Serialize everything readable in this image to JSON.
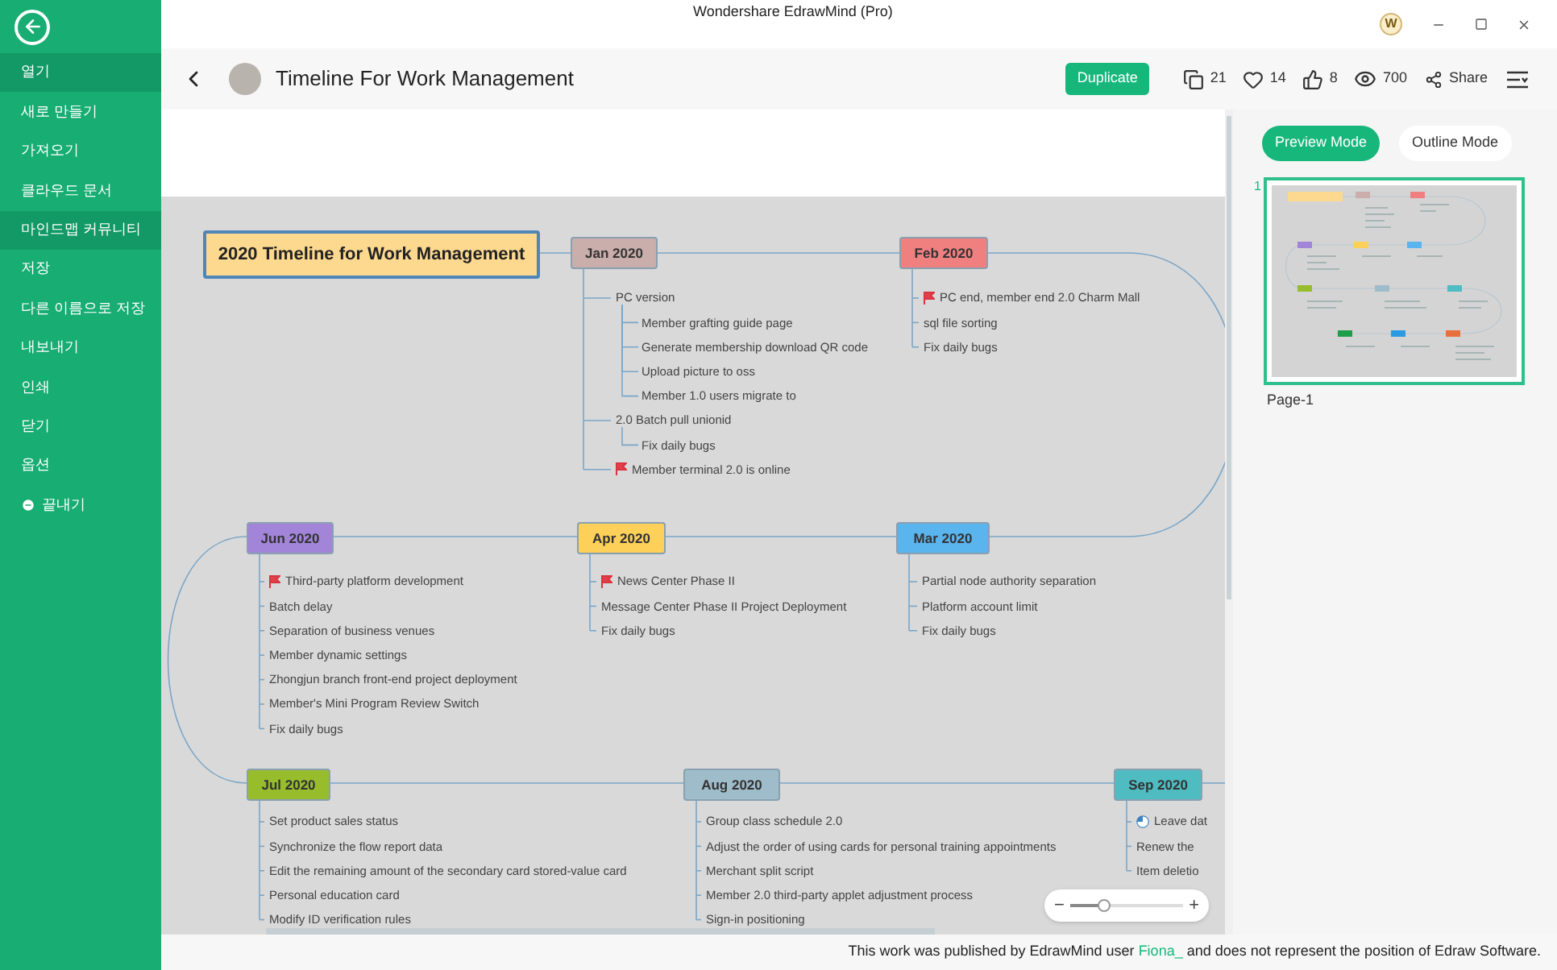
{
  "window": {
    "title": "Wondershare EdrawMind (Pro)",
    "account_badge": "W"
  },
  "sidebar": {
    "items": [
      {
        "label": "열기",
        "selected": true,
        "kind": "plain"
      },
      {
        "label": "새로 만들기",
        "selected": false,
        "kind": "plain"
      },
      {
        "label": "가져오기",
        "selected": false,
        "kind": "plain"
      },
      {
        "label": "클라우드 문서",
        "selected": false,
        "kind": "plain"
      },
      {
        "label": "마인드맵 커뮤니티",
        "selected": true,
        "kind": "plain"
      },
      {
        "label": "저장",
        "selected": false,
        "kind": "plain"
      },
      {
        "label": "다른 이름으로 저장",
        "selected": false,
        "kind": "plain"
      },
      {
        "label": "내보내기",
        "selected": false,
        "kind": "plain"
      },
      {
        "label": "인쇄",
        "selected": false,
        "kind": "plain"
      },
      {
        "label": "닫기",
        "selected": false,
        "kind": "plain"
      },
      {
        "label": "옵션",
        "selected": false,
        "kind": "plain"
      },
      {
        "label": "끝내기",
        "selected": false,
        "kind": "exit"
      }
    ]
  },
  "header": {
    "title": "Timeline For Work Management",
    "duplicate": "Duplicate",
    "copies": "21",
    "likes": "14",
    "thumbs": "8",
    "views": "700",
    "share": "Share"
  },
  "map": {
    "root": "2020 Timeline for Work Management",
    "months": [
      {
        "label": "Jan 2020",
        "color": "#c9aeab",
        "items": [
          {
            "text": "PC version",
            "children": [
              {
                "text": "Member grafting guide page"
              },
              {
                "text": "Generate membership download QR code"
              },
              {
                "text": "Upload picture to oss"
              },
              {
                "text": "Member 1.0 users migrate to"
              }
            ]
          },
          {
            "text": "2.0 Batch pull unionid",
            "children": [
              {
                "text": "Fix daily bugs"
              }
            ]
          },
          {
            "text": "Member terminal 2.0 is online",
            "flagged": true
          }
        ]
      },
      {
        "label": "Feb 2020",
        "color": "#f08080",
        "items": [
          {
            "text": "PC end, member end 2.0 Charm Mall",
            "flagged": true
          },
          {
            "text": "sql file sorting"
          },
          {
            "text": "Fix daily bugs"
          }
        ]
      },
      {
        "label": "Jun 2020",
        "color": "#a285d9",
        "items": [
          {
            "text": "Third-party platform development",
            "flagged": true
          },
          {
            "text": "Batch delay"
          },
          {
            "text": "Separation of business venues"
          },
          {
            "text": "Member dynamic settings"
          },
          {
            "text": "Zhongjun branch front-end project deployment"
          },
          {
            "text": "Member's Mini Program Review Switch"
          },
          {
            "text": "Fix daily bugs"
          }
        ]
      },
      {
        "label": "Apr 2020",
        "color": "#fdd05a",
        "items": [
          {
            "text": "News Center Phase II",
            "flagged": true
          },
          {
            "text": "Message Center Phase II Project Deployment"
          },
          {
            "text": "Fix daily bugs"
          }
        ]
      },
      {
        "label": "Mar 2020",
        "color": "#5ab4ee",
        "items": [
          {
            "text": "Partial node authority separation"
          },
          {
            "text": "Platform account limit"
          },
          {
            "text": "Fix daily bugs"
          }
        ]
      },
      {
        "label": "Jul 2020",
        "color": "#97bd2d",
        "items": [
          {
            "text": "Set product sales status"
          },
          {
            "text": "Synchronize the flow report data"
          },
          {
            "text": "Edit the remaining amount of the secondary card stored-value card"
          },
          {
            "text": "Personal education card"
          },
          {
            "text": "Modify ID verification rules"
          }
        ]
      },
      {
        "label": "Aug 2020",
        "color": "#9fbccb",
        "items": [
          {
            "text": "Group class schedule 2.0"
          },
          {
            "text": "Adjust the order of using cards for personal training appointments"
          },
          {
            "text": "Merchant split script"
          },
          {
            "text": "Member 2.0 third-party applet adjustment process"
          },
          {
            "text": "Sign-in positioning"
          }
        ]
      },
      {
        "label": "Sep 2020",
        "color": "#4fbcc1",
        "items": [
          {
            "text": "Leave dat",
            "in_progress": true
          },
          {
            "text": "Renew the"
          },
          {
            "text": "Item deletio"
          }
        ]
      }
    ]
  },
  "zoom": {
    "minus": "−",
    "plus": "+",
    "level": 0.3
  },
  "panel": {
    "modes": [
      {
        "label": "Preview Mode",
        "selected": true
      },
      {
        "label": "Outline Mode",
        "selected": false
      }
    ],
    "page_number": "1",
    "page_label": "Page-1"
  },
  "footer": {
    "before": "This work was published by EdrawMind user",
    "link": "Fiona_",
    "after": "and does not represent the position of Edraw Software."
  }
}
